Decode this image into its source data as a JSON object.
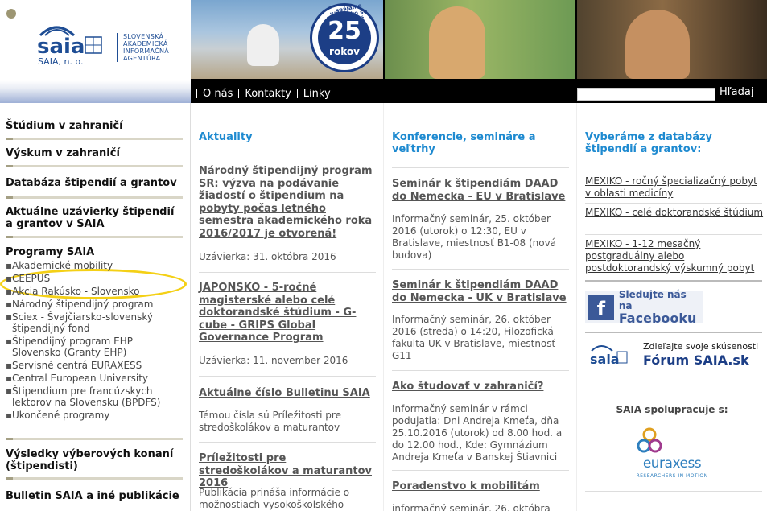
{
  "logo": {
    "brand": "saia",
    "brand_sub": "SAIA, n. o.",
    "desc": [
      "SLOVENSKÁ",
      "AKADEMICKÁ",
      "INFORMAČNÁ",
      "AGENTÚRA"
    ]
  },
  "banner": {
    "seal_number": "25",
    "seal_label": "rokov",
    "seal_text": "...spájame Slovensko so svetom už"
  },
  "nav": {
    "items": [
      "O nás",
      "Kontakty",
      "Linky"
    ],
    "search_label": "Hľadaj"
  },
  "sidebar": {
    "items": [
      "Štúdium v zahraničí",
      "Výskum v zahraničí",
      "Databáza štipendií a grantov",
      "Aktuálne uzávierky štipendií a grantov v SAIA"
    ],
    "programs_title": "Programy SAIA",
    "programs": [
      "Akademické mobility",
      "CEEPUS",
      "Akcia Rakúsko - Slovensko",
      "Národný štipendijný program",
      "Sciex - Švajčiarsko-slovenský štipendijný fond",
      "Štipendijný program EHP Slovensko (Granty EHP)",
      "Servisné centrá EURAXESS",
      "Central European University",
      "Štipendium pre francúzskych lektorov na Slovensku (BPDFS)",
      "Ukončené programy"
    ],
    "results": "Výsledky výberových konaní (štipendisti)",
    "bulletin": "Bulletin SAIA a iné publikácie"
  },
  "news": {
    "heading": "Aktuality",
    "articles": [
      {
        "title": "Národný štipendijný program SR: výzva na podávanie žiadostí o štipendium na pobyty počas letného semestra akademického roka 2016/2017 je otvorená!",
        "text": "Uzávierka: 31. októbra 2016"
      },
      {
        "title": "JAPONSKO - 5-ročné magisterské alebo celé doktorandské štúdium - G-cube - GRIPS Global Governance Program",
        "text": "Uzávierka: 11. november 2016"
      },
      {
        "title": "Aktuálne číslo Bulletinu SAIA",
        "text": "Témou čísla sú Príležitosti pre stredoškolákov a maturantov"
      },
      {
        "title": "Príležitosti pre stredoškolákov a maturantov 2016",
        "text": "Publikácia prináša informácie o možnostiach vysokoškolského"
      }
    ]
  },
  "conf": {
    "heading": "Konferencie, semináre a veľtrhy",
    "articles": [
      {
        "title": "Seminár k štipendiám DAAD do Nemecka - EU v Bratislave",
        "text": "Informačný seminár, 25. október 2016 (utorok) o 12:30, EU v Bratislave, miestnosť B1-08 (nová budova)"
      },
      {
        "title": "Seminár k štipendiám DAAD do Nemecka - UK v Bratislave",
        "text": "Informačný seminár, 26. október 2016 (streda) o 14:20, Filozofická fakulta UK v Bratislave, miestnosť G11"
      },
      {
        "title": "Ako študovať v zahraničí?",
        "text": "Informačný seminár v rámci podujatia: Dni Andreja Kmeťa, dňa 25.10.2016 (utorok) od 8.00 hod. a do 12.00 hod., Kde: Gymnázium Andreja Kmeťa v Banskej Štiavnici"
      },
      {
        "title": "Poradenstvo k mobilitám",
        "text": "informačný seminár, 26. októbra"
      }
    ]
  },
  "db": {
    "heading": "Vyberáme z databázy štipendií a grantov:",
    "links": [
      "MEXIKO - ročný špecializačný pobyt v oblasti medicíny",
      "MEXIKO - celé doktorandské štúdium",
      "MEXIKO - 1-12 mesačný postgraduálny alebo postdoktorandský výskumný pobyt"
    ],
    "fb_line1": "Sledujte nás na",
    "fb_line2": "Facebooku",
    "fb_icon": "f",
    "forum_sub": "Zdieľajte svoje skúsenosti",
    "forum_title": "Fórum SAIA.sk",
    "forum_brand": "saia",
    "coop": "SAIA spolupracuje s:",
    "euraxess": "euraxess",
    "euraxess_sub": "RESEARCHERS IN MOTION"
  }
}
